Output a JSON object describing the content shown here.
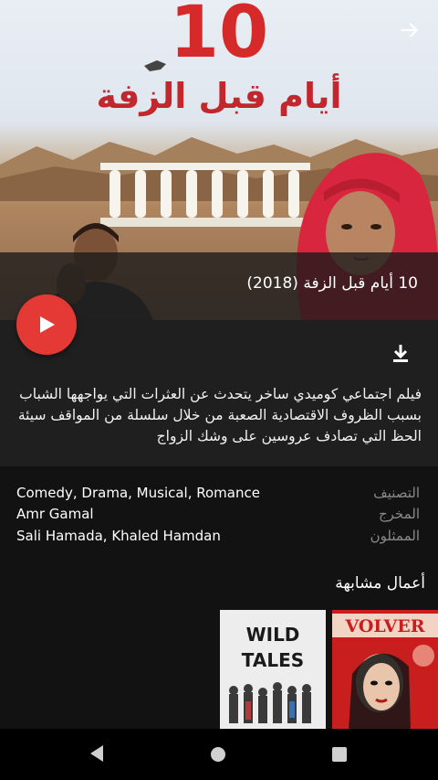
{
  "poster": {
    "title_art": "أيام قبل الزفة",
    "title_number_art": "10"
  },
  "header": {
    "back_icon": "arrow-right-icon"
  },
  "movie": {
    "title": "10 أيام قبل الزفة (2018)",
    "description": "فيلم اجتماعي كوميدي ساخر يتحدث عن العثرات التي يواجهها الشباب بسبب الظروف الاقتصادية الصعبة من خلال سلسلة من المواقف سيئة الحظ التي تصادف عروسين على وشك الزواج"
  },
  "actions": {
    "play_icon": "play-icon",
    "download_icon": "download-icon"
  },
  "meta": [
    {
      "label": "التصنيف",
      "value": "Comedy, Drama, Musical, Romance"
    },
    {
      "label": "المخرج",
      "value": "Amr Gamal"
    },
    {
      "label": "الممثلون",
      "value": "Sali Hamada, Khaled Hamdan"
    }
  ],
  "similar": {
    "heading": "أعمال مشابهة",
    "items": [
      {
        "title": "VOLVER"
      },
      {
        "title_line1": "WILD",
        "title_line2": "TALES"
      }
    ]
  },
  "colors": {
    "accent": "#e53935",
    "background": "#121212",
    "panel": "#1f1f1f"
  }
}
